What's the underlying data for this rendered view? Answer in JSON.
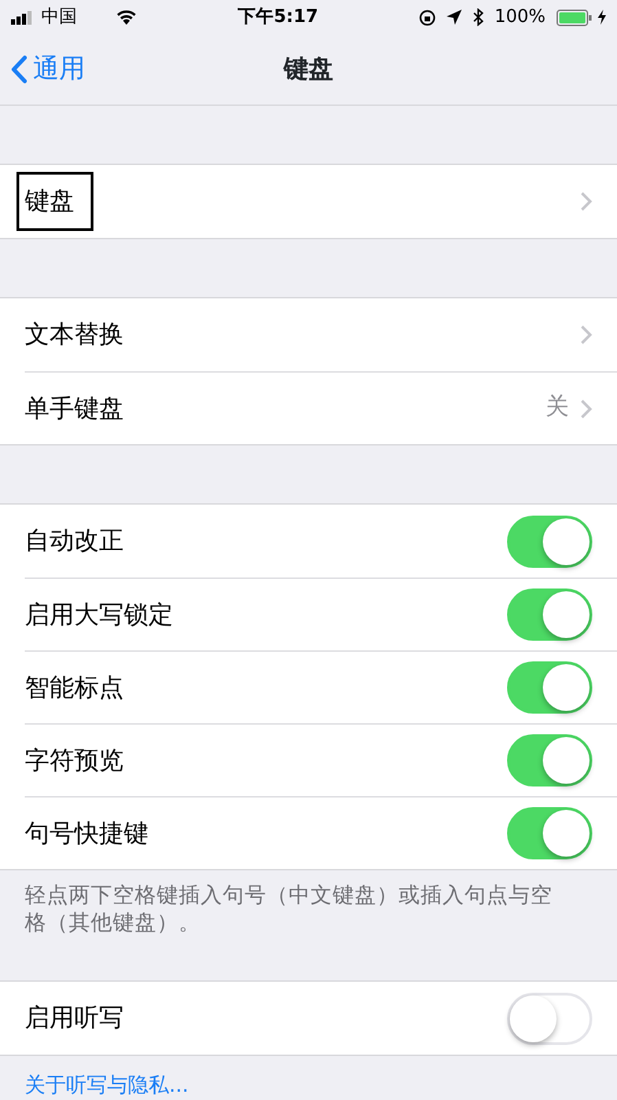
{
  "status_bar": {
    "carrier": "中国",
    "time": "下午5:17",
    "battery": "100%"
  },
  "nav": {
    "back": "通用",
    "title": "键盘"
  },
  "groups": [
    {
      "rows": [
        {
          "kind": "link",
          "label": "键盘",
          "outlined": true
        }
      ]
    },
    {
      "rows": [
        {
          "kind": "link",
          "label": "文本替换",
          "outlined": false
        },
        {
          "kind": "link",
          "label": "单手键盘",
          "value": "关",
          "outlined": false
        }
      ]
    },
    {
      "rows": [
        {
          "kind": "toggle",
          "label": "自动改正",
          "on": true
        },
        {
          "kind": "toggle",
          "label": "启用大写锁定",
          "on": true
        },
        {
          "kind": "toggle",
          "label": "智能标点",
          "on": true
        },
        {
          "kind": "toggle",
          "label": "字符预览",
          "on": true
        },
        {
          "kind": "toggle",
          "label": "句号快捷键",
          "on": true
        }
      ],
      "footer": "轻点两下空格键插入句号（中文键盘）或插入句点与空格（其他键盘）。"
    },
    {
      "rows": [
        {
          "kind": "toggle",
          "label": "启用听写",
          "on": false
        }
      ],
      "footer_link": "关于听写与隐私..."
    }
  ]
}
